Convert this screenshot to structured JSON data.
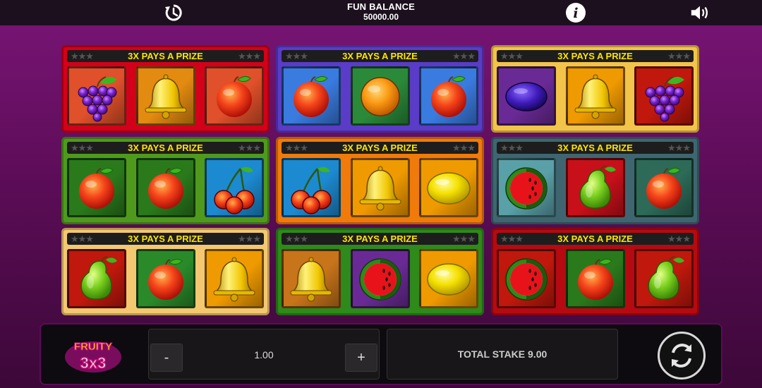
{
  "header": {
    "history_icon": "history-icon",
    "balance_label": "FUN BALANCE",
    "balance_value": "50000.00",
    "info_icon": "info-icon",
    "sound_icon": "speaker-icon"
  },
  "cards": [
    {
      "title": "3X PAYS A PRIZE",
      "color": "#d4001a",
      "symbols": [
        "grapes",
        "bell",
        "orange-red"
      ]
    },
    {
      "title": "3X PAYS A PRIZE",
      "color": "#5a3cc8",
      "symbols": [
        "orange-red",
        "orange",
        "orange-red"
      ]
    },
    {
      "title": "3X PAYS A PRIZE",
      "color": "#f3c44a",
      "symbols": [
        "plum",
        "bell",
        "grapes"
      ]
    },
    {
      "title": "3X PAYS A PRIZE",
      "color": "#4f9a1c",
      "symbols": [
        "orange-red",
        "orange-red",
        "cherries"
      ]
    },
    {
      "title": "3X PAYS A PRIZE",
      "color": "#f07a0a",
      "symbols": [
        "cherries",
        "bell",
        "lemon"
      ]
    },
    {
      "title": "3X PAYS A PRIZE",
      "color": "#3f6670",
      "symbols": [
        "watermelon",
        "pear",
        "orange-red"
      ]
    },
    {
      "title": "3X PAYS A PRIZE",
      "color": "#f3c870",
      "symbols": [
        "pear",
        "orange-red",
        "bell"
      ]
    },
    {
      "title": "3X PAYS A PRIZE",
      "color": "#2e8a1a",
      "symbols": [
        "bell",
        "watermelon",
        "lemon"
      ]
    },
    {
      "title": "3X PAYS A PRIZE",
      "color": "#b50a12",
      "symbols": [
        "watermelon",
        "orange-red",
        "pear"
      ]
    }
  ],
  "controls": {
    "logo_line1": "FRUITY",
    "logo_line2": "3x3",
    "minus_label": "-",
    "stake_value": "1.00",
    "plus_label": "+",
    "total_stake": "TOTAL STAKE 9.00",
    "spin_icon": "spin-icon"
  }
}
